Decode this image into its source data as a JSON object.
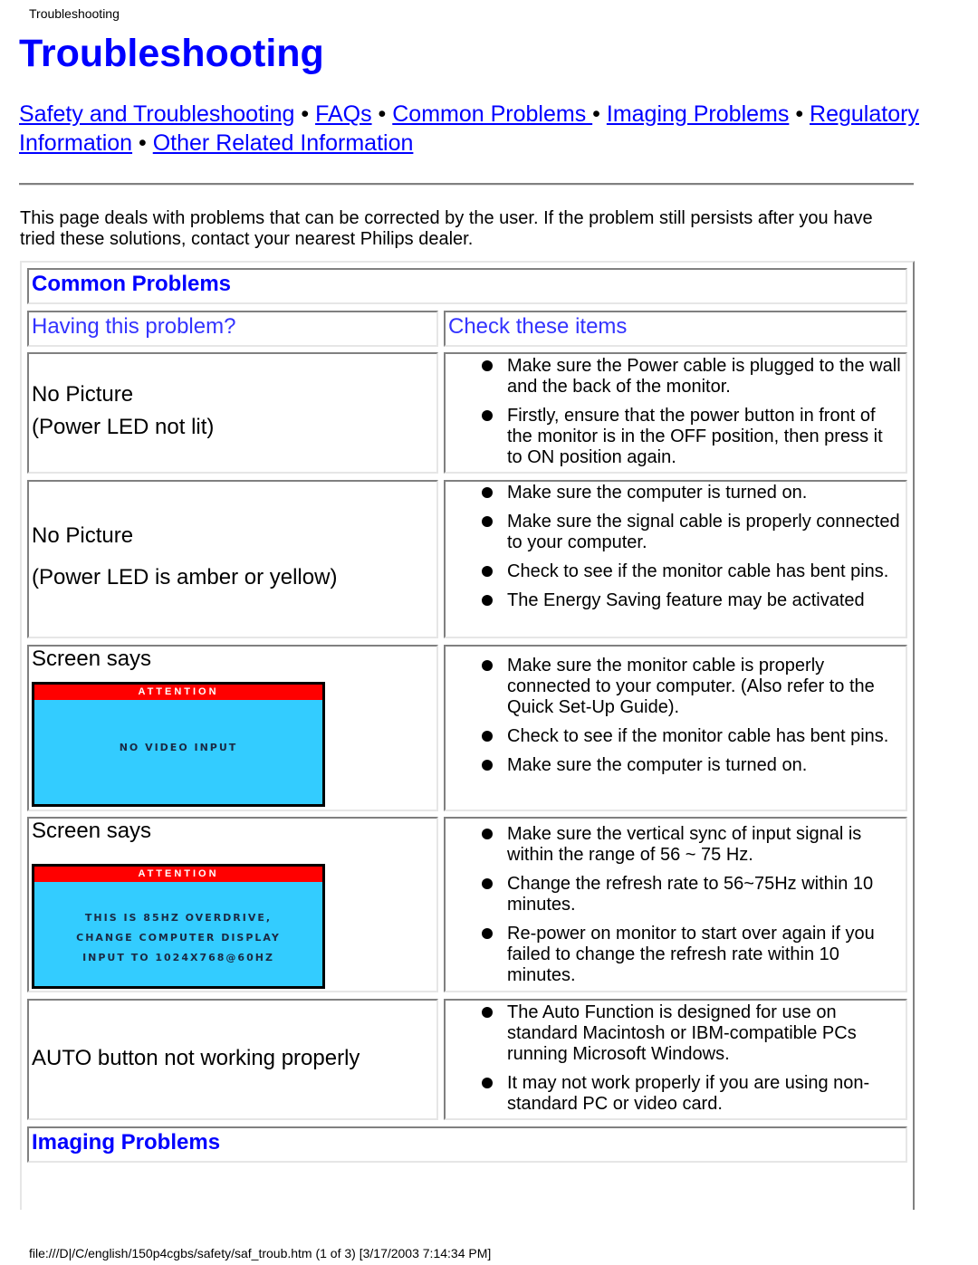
{
  "header": {
    "doc_title": "Troubleshooting",
    "page_title": "Troubleshooting"
  },
  "nav": {
    "links": [
      {
        "label": "Safety and Troubleshooting"
      },
      {
        "label": "FAQs"
      },
      {
        "label": "Common Problems "
      },
      {
        "label": "Imaging Problems"
      },
      {
        "label": "Regulatory Information"
      },
      {
        "label": "Other Related Information"
      }
    ],
    "separator": "•"
  },
  "intro": "This page deals with problems that can be corrected by the user. If the problem still persists after you have tried these solutions, contact your nearest Philips dealer.",
  "table": {
    "section_common": "Common Problems",
    "col_problem": "Having this problem?",
    "col_check": "Check these items",
    "rows": [
      {
        "problem_lines": [
          "No Picture",
          "(Power LED not lit)"
        ],
        "items": [
          "Make sure the Power cable is plugged to the wall and the back of the monitor.",
          "Firstly, ensure that the power button in front of the monitor is in the OFF position, then press it to ON position again."
        ]
      },
      {
        "problem_lines": [
          "No Picture",
          "(Power LED is amber or yellow)"
        ],
        "items": [
          "Make sure the computer is turned on.",
          "Make sure the signal cable is properly connected to your computer.",
          "Check to see if the monitor cable has bent pins.",
          "The Energy Saving feature may be activated"
        ]
      },
      {
        "problem_lines": [
          "Screen says"
        ],
        "osd": {
          "header": "ATTENTION",
          "lines": [
            "NO VIDEO INPUT"
          ]
        },
        "items": [
          "Make sure the monitor cable is properly connected to your computer. (Also refer to the Quick Set-Up Guide).",
          "Check to see if the monitor cable has bent pins.",
          "Make sure the computer is turned on."
        ]
      },
      {
        "problem_lines": [
          "Screen says"
        ],
        "osd": {
          "header": "ATTENTION",
          "lines": [
            "THIS IS 85HZ OVERDRIVE,",
            "CHANGE COMPUTER DISPLAY",
            "INPUT TO 1024X768@60HZ"
          ]
        },
        "items": [
          "Make sure the vertical sync of input signal is within the range of 56 ~ 75 Hz.",
          "Change the refresh rate to 56~75Hz within 10 minutes.",
          "Re-power on monitor to start over again if you failed to change the refresh rate within 10 minutes."
        ]
      },
      {
        "problem_lines": [
          "AUTO button not working properly"
        ],
        "items": [
          "The Auto Function is designed for use on standard Macintosh or IBM-compatible PCs running Microsoft Windows.",
          "It may not work properly if you are using non-standard PC or video card."
        ]
      }
    ],
    "section_imaging": "Imaging Problems"
  },
  "footer": "file:///D|/C/english/150p4cgbs/safety/saf_troub.htm (1 of 3) [3/17/2003 7:14:34 PM]",
  "colors": {
    "link": "#0000ff",
    "osd_bg": "#33ccff",
    "osd_header": "#ff0000"
  }
}
